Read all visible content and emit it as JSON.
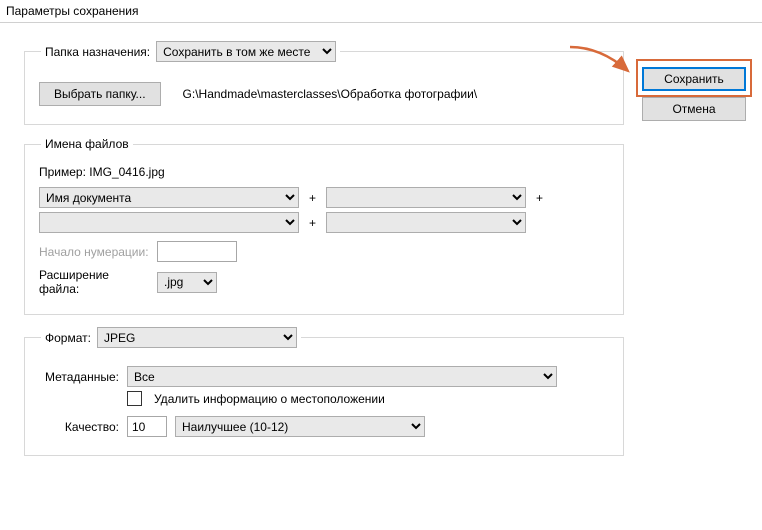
{
  "window": {
    "title": "Параметры сохранения"
  },
  "side": {
    "save": "Сохранить",
    "cancel": "Отмена"
  },
  "destination": {
    "legend_label": "Папка назначения:",
    "mode": "Сохранить в том же месте",
    "browse_btn": "Выбрать папку...",
    "path": "G:\\Handmade\\masterclasses\\Обработка фотографии\\"
  },
  "filenames": {
    "legend": "Имена файлов",
    "example_label": "Пример:",
    "example_value": "IMG_0416.jpg",
    "template1": "Имя документа",
    "template2": "",
    "template3": "",
    "template4": "",
    "plus": "+",
    "start_numbering_label": "Начало нумерации:",
    "start_numbering_value": "",
    "extension_label": "Расширение файла:",
    "extension_value": ".jpg"
  },
  "format": {
    "legend_label": "Формат:",
    "format_value": "JPEG",
    "metadata_label": "Метаданные:",
    "metadata_value": "Все",
    "remove_location_label": "Удалить информацию о местоположении",
    "remove_location_checked": false,
    "quality_label": "Качество:",
    "quality_value": "10",
    "quality_preset": "Наилучшее  (10-12)"
  }
}
